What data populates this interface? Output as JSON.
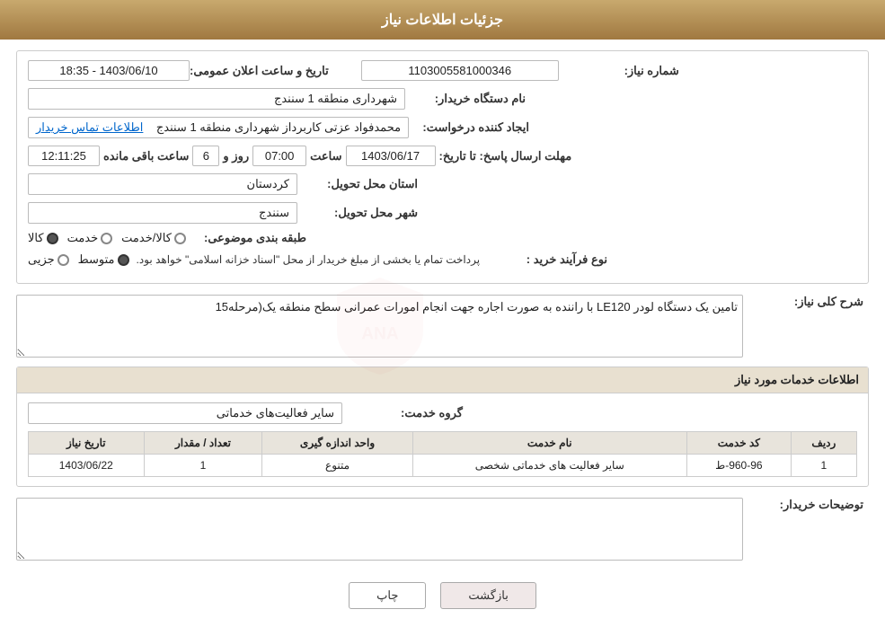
{
  "page": {
    "title": "جزئیات اطلاعات نیاز"
  },
  "header": {
    "announcement_label": "تاریخ و ساعت اعلان عمومی:",
    "announcement_value": "1403/06/10 - 18:35",
    "need_number_label": "شماره نیاز:",
    "need_number_value": "1103005581000346",
    "buyer_org_label": "نام دستگاه خریدار:",
    "buyer_org_value": "شهرداری منطقه 1 سنندج",
    "requester_label": "ایجاد کننده درخواست:",
    "requester_value": "محمدفواد عزتی کاربرداز شهرداری منطقه 1 سنندج",
    "requester_contact_link": "اطلاعات تماس خریدار",
    "deadline_label": "مهلت ارسال پاسخ: تا تاریخ:",
    "deadline_date": "1403/06/17",
    "deadline_time_label": "ساعت",
    "deadline_time": "07:00",
    "deadline_day_label": "روز و",
    "deadline_days": "6",
    "deadline_remaining_label": "ساعت باقی مانده",
    "deadline_remaining": "12:11:25",
    "province_label": "استان محل تحویل:",
    "province_value": "کردستان",
    "city_label": "شهر محل تحویل:",
    "city_value": "سنندج",
    "category_label": "طبقه بندی موضوعی:",
    "category_options": [
      "کالا",
      "خدمت",
      "کالا/خدمت"
    ],
    "category_selected": "کالا",
    "process_label": "نوع فرآیند خرید :",
    "process_options": [
      "جزیی",
      "متوسط"
    ],
    "process_selected": "متوسط",
    "process_note": "پرداخت تمام یا بخشی از مبلغ خریدار از محل \"اسناد خزانه اسلامی\" خواهد بود."
  },
  "description_section": {
    "label": "شرح کلی نیاز:",
    "value": "تامین یک دستگاه لودر LE120 با راننده به صورت اجاره جهت انجام امورات عمرانی سطح منطقه یک(مرحله15"
  },
  "services_section": {
    "title": "اطلاعات خدمات مورد نیاز",
    "group_label": "گروه خدمت:",
    "group_value": "سایر فعالیت‌های خدماتی",
    "table": {
      "headers": [
        "ردیف",
        "کد خدمت",
        "نام خدمت",
        "واحد اندازه گیری",
        "تعداد / مقدار",
        "تاریخ نیاز"
      ],
      "rows": [
        {
          "row": "1",
          "code": "960-96-ط",
          "name": "سایر فعالیت های خدماتی شخصی",
          "unit": "متنوع",
          "qty": "1",
          "date": "1403/06/22"
        }
      ]
    }
  },
  "buyer_notes_label": "توضیحات خریدار:",
  "buyer_notes_value": "",
  "buttons": {
    "print": "چاپ",
    "back": "بازگشت"
  }
}
